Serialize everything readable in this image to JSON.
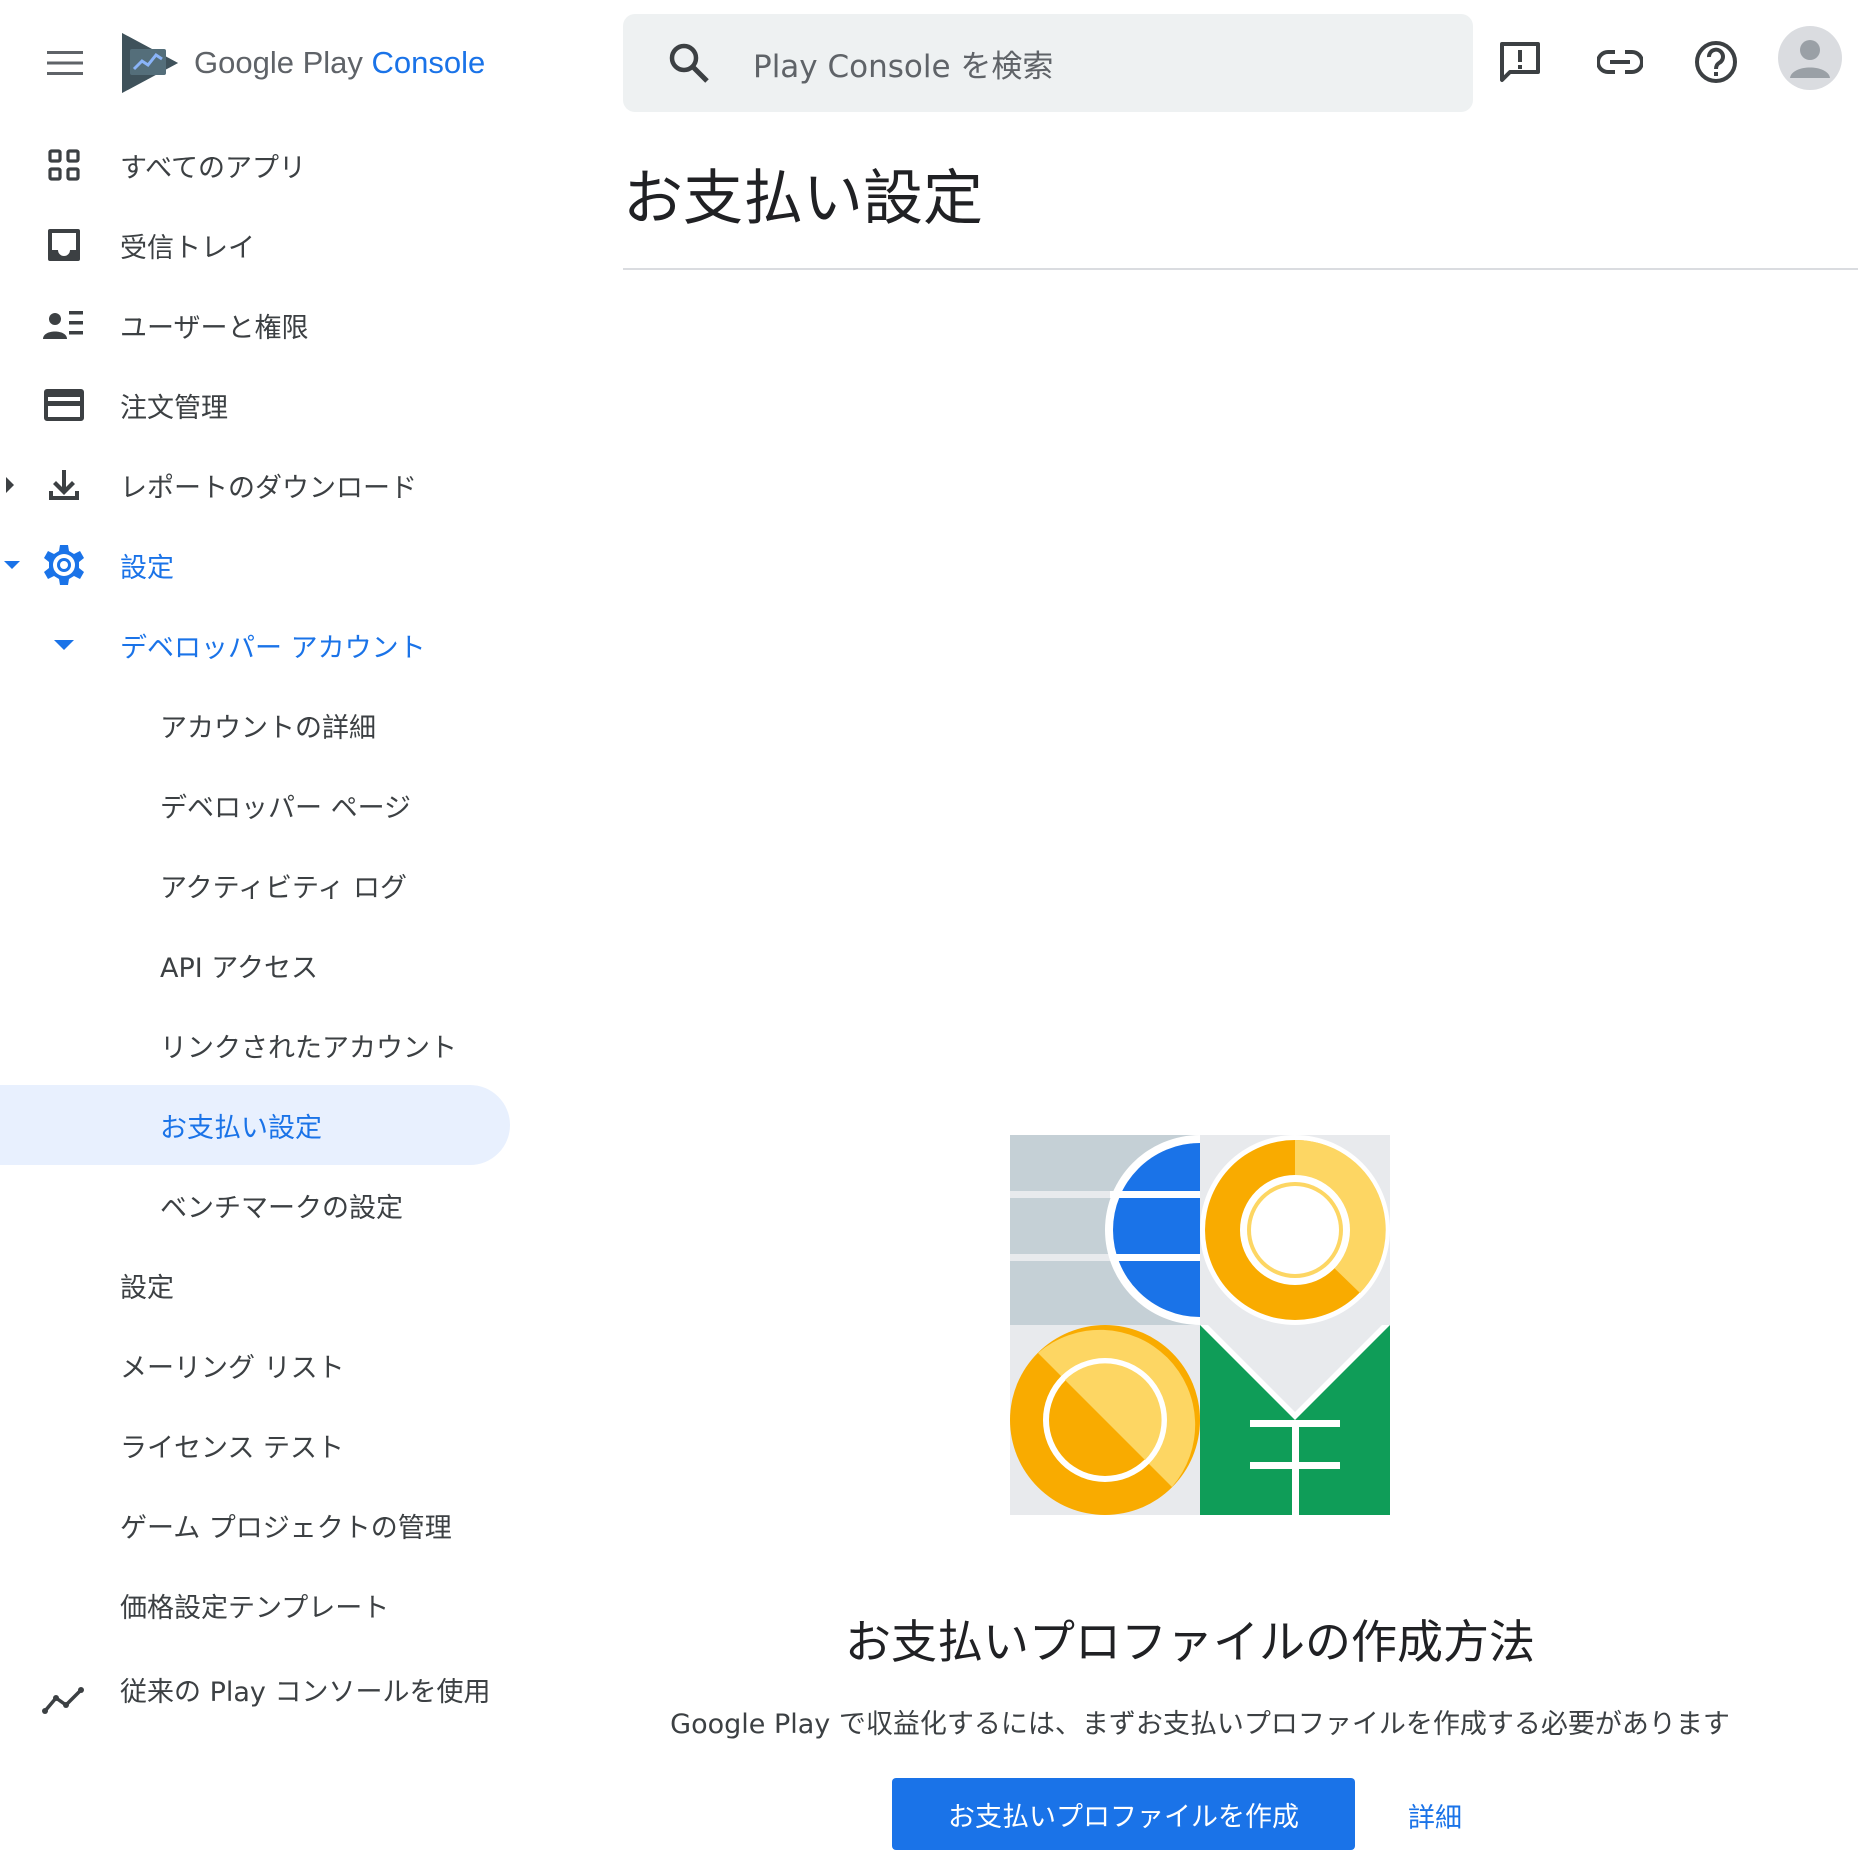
{
  "brand": {
    "name": "Google Play",
    "product": "Console"
  },
  "search": {
    "placeholder": "Play Console を検索"
  },
  "top_icons": [
    "feedback-icon",
    "link-icon",
    "help-icon",
    "account-avatar"
  ],
  "sidebar": {
    "items": [
      {
        "label": "すべてのアプリ",
        "icon": "apps-grid-icon"
      },
      {
        "label": "受信トレイ",
        "icon": "inbox-icon"
      },
      {
        "label": "ユーザーと権限",
        "icon": "users-permissions-icon"
      },
      {
        "label": "注文管理",
        "icon": "credit-card-icon"
      },
      {
        "label": "レポートのダウンロード",
        "icon": "download-icon",
        "expandable": true
      },
      {
        "label": "設定",
        "icon": "gear-icon",
        "expanded": true
      },
      {
        "label": "デベロッパー アカウント",
        "expanded": true
      },
      {
        "label": "アカウントの詳細"
      },
      {
        "label": "デベロッパー ページ"
      },
      {
        "label": "アクティビティ ログ"
      },
      {
        "label": "API アクセス"
      },
      {
        "label": "リンクされたアカウント"
      },
      {
        "label": "お支払い設定",
        "selected": true
      },
      {
        "label": "ベンチマークの設定"
      },
      {
        "label": "設定"
      },
      {
        "label": "メーリング リスト"
      },
      {
        "label": "ライセンス テスト"
      },
      {
        "label": "ゲーム プロジェクトの管理"
      },
      {
        "label": "価格設定テンプレート"
      }
    ],
    "legacy": {
      "label": "従来の Play コンソールを使用",
      "icon": "trend-line-icon"
    }
  },
  "main": {
    "title": "お支払い設定",
    "empty_state": {
      "heading": "お支払いプロファイルの作成方法",
      "description": "Google Play で収益化するには、まずお支払いプロファイルを作成する必要があります",
      "primary_button": "お支払いプロファイルを作成",
      "link": "詳細"
    }
  },
  "colors": {
    "accent": "#1a73e8",
    "selected_bg": "#e8f0fe",
    "text": "#3c4043",
    "title": "#202124",
    "search_bg": "#eef1f2",
    "illus_blue": "#1a73e8",
    "illus_yellow": "#fdd663",
    "illus_orange": "#f9ab00",
    "illus_green": "#0f9d58",
    "illus_gray": "#c5d0d6"
  }
}
